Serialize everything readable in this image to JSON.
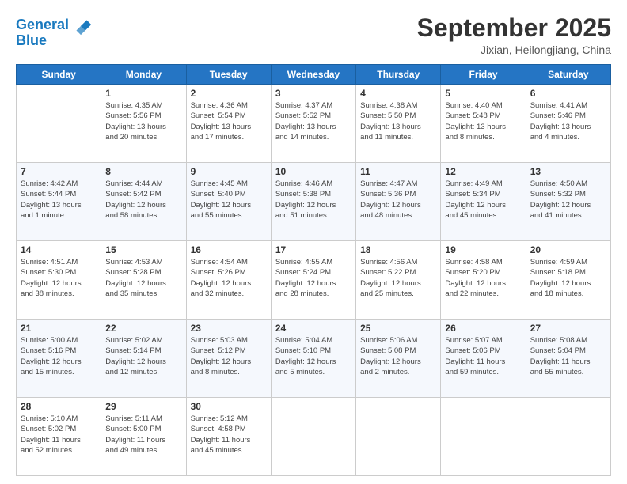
{
  "header": {
    "logo_line1": "General",
    "logo_line2": "Blue",
    "month": "September 2025",
    "location": "Jixian, Heilongjiang, China"
  },
  "weekdays": [
    "Sunday",
    "Monday",
    "Tuesday",
    "Wednesday",
    "Thursday",
    "Friday",
    "Saturday"
  ],
  "weeks": [
    [
      {
        "day": "",
        "info": ""
      },
      {
        "day": "1",
        "info": "Sunrise: 4:35 AM\nSunset: 5:56 PM\nDaylight: 13 hours\nand 20 minutes."
      },
      {
        "day": "2",
        "info": "Sunrise: 4:36 AM\nSunset: 5:54 PM\nDaylight: 13 hours\nand 17 minutes."
      },
      {
        "day": "3",
        "info": "Sunrise: 4:37 AM\nSunset: 5:52 PM\nDaylight: 13 hours\nand 14 minutes."
      },
      {
        "day": "4",
        "info": "Sunrise: 4:38 AM\nSunset: 5:50 PM\nDaylight: 13 hours\nand 11 minutes."
      },
      {
        "day": "5",
        "info": "Sunrise: 4:40 AM\nSunset: 5:48 PM\nDaylight: 13 hours\nand 8 minutes."
      },
      {
        "day": "6",
        "info": "Sunrise: 4:41 AM\nSunset: 5:46 PM\nDaylight: 13 hours\nand 4 minutes."
      }
    ],
    [
      {
        "day": "7",
        "info": "Sunrise: 4:42 AM\nSunset: 5:44 PM\nDaylight: 13 hours\nand 1 minute."
      },
      {
        "day": "8",
        "info": "Sunrise: 4:44 AM\nSunset: 5:42 PM\nDaylight: 12 hours\nand 58 minutes."
      },
      {
        "day": "9",
        "info": "Sunrise: 4:45 AM\nSunset: 5:40 PM\nDaylight: 12 hours\nand 55 minutes."
      },
      {
        "day": "10",
        "info": "Sunrise: 4:46 AM\nSunset: 5:38 PM\nDaylight: 12 hours\nand 51 minutes."
      },
      {
        "day": "11",
        "info": "Sunrise: 4:47 AM\nSunset: 5:36 PM\nDaylight: 12 hours\nand 48 minutes."
      },
      {
        "day": "12",
        "info": "Sunrise: 4:49 AM\nSunset: 5:34 PM\nDaylight: 12 hours\nand 45 minutes."
      },
      {
        "day": "13",
        "info": "Sunrise: 4:50 AM\nSunset: 5:32 PM\nDaylight: 12 hours\nand 41 minutes."
      }
    ],
    [
      {
        "day": "14",
        "info": "Sunrise: 4:51 AM\nSunset: 5:30 PM\nDaylight: 12 hours\nand 38 minutes."
      },
      {
        "day": "15",
        "info": "Sunrise: 4:53 AM\nSunset: 5:28 PM\nDaylight: 12 hours\nand 35 minutes."
      },
      {
        "day": "16",
        "info": "Sunrise: 4:54 AM\nSunset: 5:26 PM\nDaylight: 12 hours\nand 32 minutes."
      },
      {
        "day": "17",
        "info": "Sunrise: 4:55 AM\nSunset: 5:24 PM\nDaylight: 12 hours\nand 28 minutes."
      },
      {
        "day": "18",
        "info": "Sunrise: 4:56 AM\nSunset: 5:22 PM\nDaylight: 12 hours\nand 25 minutes."
      },
      {
        "day": "19",
        "info": "Sunrise: 4:58 AM\nSunset: 5:20 PM\nDaylight: 12 hours\nand 22 minutes."
      },
      {
        "day": "20",
        "info": "Sunrise: 4:59 AM\nSunset: 5:18 PM\nDaylight: 12 hours\nand 18 minutes."
      }
    ],
    [
      {
        "day": "21",
        "info": "Sunrise: 5:00 AM\nSunset: 5:16 PM\nDaylight: 12 hours\nand 15 minutes."
      },
      {
        "day": "22",
        "info": "Sunrise: 5:02 AM\nSunset: 5:14 PM\nDaylight: 12 hours\nand 12 minutes."
      },
      {
        "day": "23",
        "info": "Sunrise: 5:03 AM\nSunset: 5:12 PM\nDaylight: 12 hours\nand 8 minutes."
      },
      {
        "day": "24",
        "info": "Sunrise: 5:04 AM\nSunset: 5:10 PM\nDaylight: 12 hours\nand 5 minutes."
      },
      {
        "day": "25",
        "info": "Sunrise: 5:06 AM\nSunset: 5:08 PM\nDaylight: 12 hours\nand 2 minutes."
      },
      {
        "day": "26",
        "info": "Sunrise: 5:07 AM\nSunset: 5:06 PM\nDaylight: 11 hours\nand 59 minutes."
      },
      {
        "day": "27",
        "info": "Sunrise: 5:08 AM\nSunset: 5:04 PM\nDaylight: 11 hours\nand 55 minutes."
      }
    ],
    [
      {
        "day": "28",
        "info": "Sunrise: 5:10 AM\nSunset: 5:02 PM\nDaylight: 11 hours\nand 52 minutes."
      },
      {
        "day": "29",
        "info": "Sunrise: 5:11 AM\nSunset: 5:00 PM\nDaylight: 11 hours\nand 49 minutes."
      },
      {
        "day": "30",
        "info": "Sunrise: 5:12 AM\nSunset: 4:58 PM\nDaylight: 11 hours\nand 45 minutes."
      },
      {
        "day": "",
        "info": ""
      },
      {
        "day": "",
        "info": ""
      },
      {
        "day": "",
        "info": ""
      },
      {
        "day": "",
        "info": ""
      }
    ]
  ]
}
